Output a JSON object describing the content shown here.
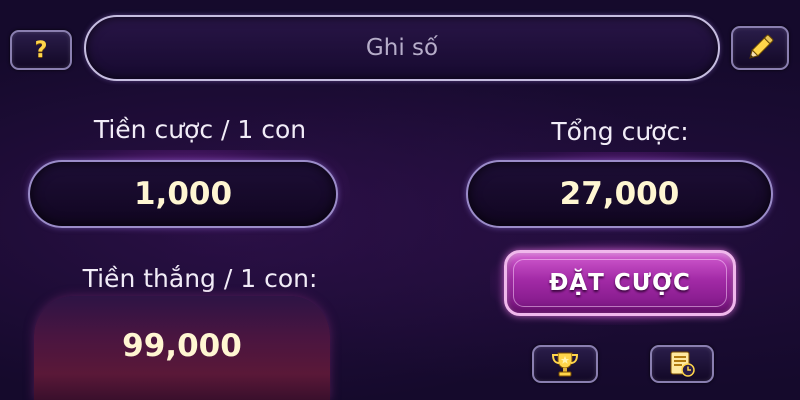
{
  "header": {
    "help_symbol": "?",
    "number_field_placeholder": "Ghi số"
  },
  "bet_per_number": {
    "label": "Tiền cược / 1 con",
    "value": "1,000"
  },
  "total_bet": {
    "label": "Tổng cược:",
    "value": "27,000"
  },
  "win_per_number": {
    "label": "Tiền thắng / 1 con:",
    "value": "99,000"
  },
  "actions": {
    "place_bet_label": "ĐẶT CƯỢC"
  },
  "icons": {
    "help": "question-icon",
    "edit": "pencil-icon",
    "leaderboard": "trophy-icon",
    "history": "history-icon"
  },
  "colors": {
    "background": "#150a2c",
    "value_text": "#fff6d2",
    "bet_button": "#a22aa6",
    "icon_gold": "#ffd54a"
  }
}
